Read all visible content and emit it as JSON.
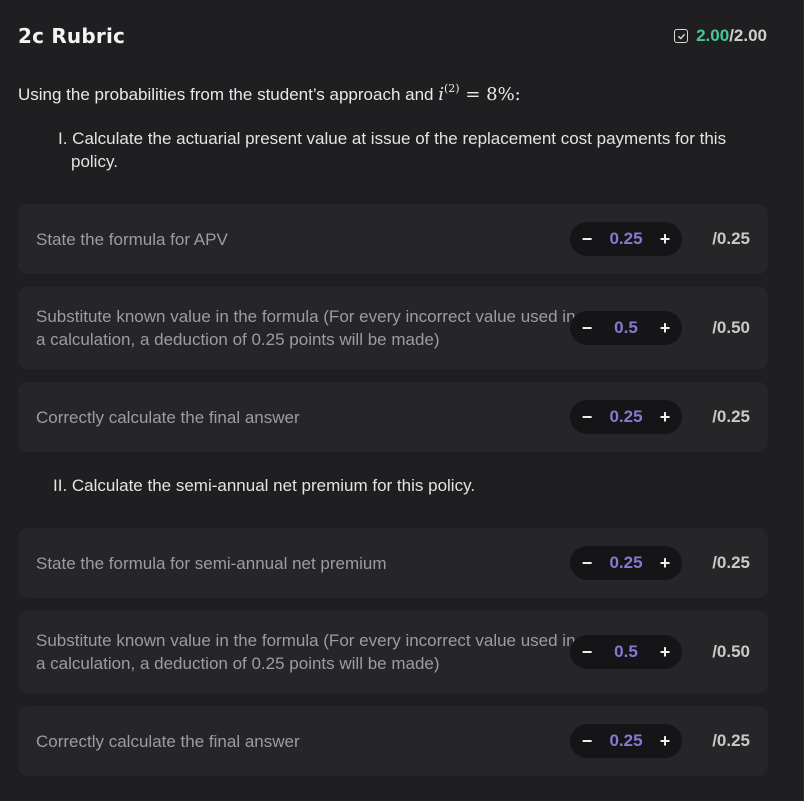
{
  "header": {
    "title": "2c Rubric",
    "score_earned": "2.00",
    "score_sep_total": "/2.00"
  },
  "prompt": {
    "text": "Using the probabilities from the student’s approach and",
    "math_var": "i",
    "math_sup": "(2)",
    "math_rest": " = 8%:"
  },
  "parts": [
    "I. Calculate the actuarial present value at issue of the replacement cost payments for this policy.",
    "II. Calculate the semi-annual net premium for this policy."
  ],
  "criteria": [
    {
      "text": "State the formula for APV",
      "value": "0.25",
      "max": "/0.25"
    },
    {
      "text": "Substitute known value in the formula (For every incorrect value used in a calculation, a deduction of 0.25 points will be made)",
      "value": "0.5",
      "max": "/0.50"
    },
    {
      "text": "Correctly calculate the final answer",
      "value": "0.25",
      "max": "/0.25"
    },
    {
      "text": "State the formula for semi-annual net premium",
      "value": "0.25",
      "max": "/0.25"
    },
    {
      "text": "Substitute known value in the formula (For every incorrect value used in a calculation, a deduction of 0.25 points will be made)",
      "value": "0.5",
      "max": "/0.50"
    },
    {
      "text": "Correctly calculate the final answer",
      "value": "0.25",
      "max": "/0.25"
    }
  ],
  "stepper_icons": {
    "minus": "−",
    "plus": "+"
  },
  "colors": {
    "earned": "#45c79a",
    "value": "#8a78d0",
    "background": "#1f1f21",
    "card": "#262628"
  }
}
